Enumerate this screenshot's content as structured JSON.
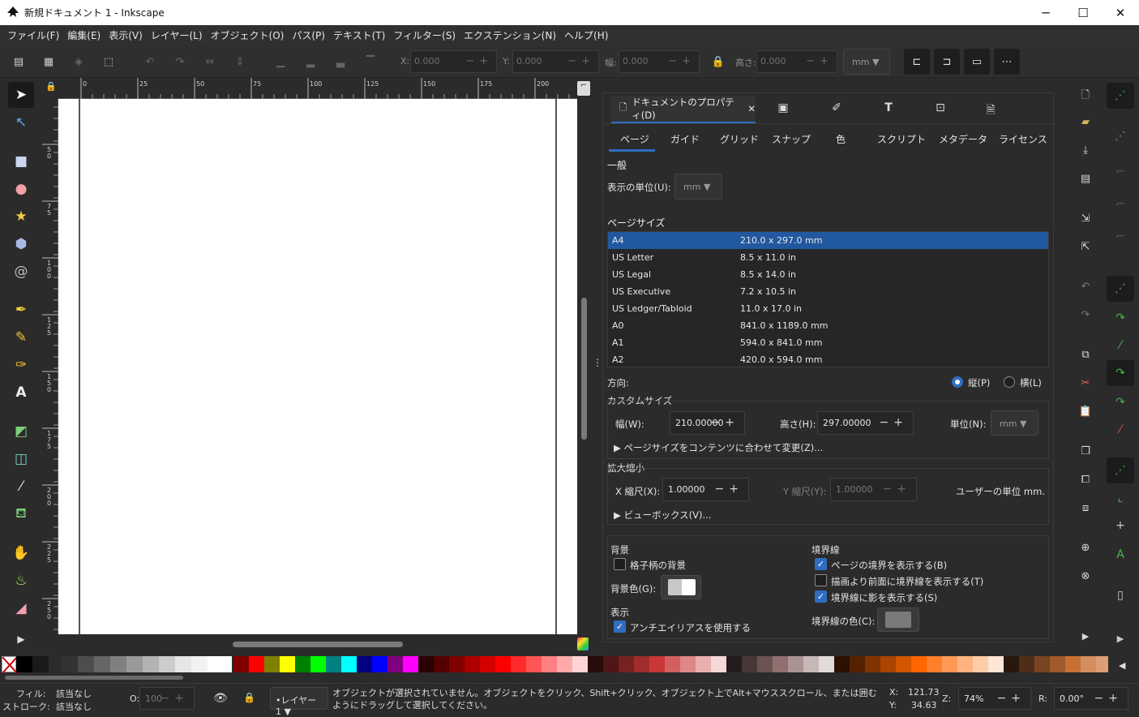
{
  "window": {
    "title": "新規ドキュメント 1 - Inkscape",
    "minimize": "─",
    "maximize": "☐",
    "close": "✕"
  },
  "menu": [
    "ファイル(F)",
    "編集(E)",
    "表示(V)",
    "レイヤー(L)",
    "オブジェクト(O)",
    "パス(P)",
    "テキスト(T)",
    "フィルター(S)",
    "エクステンション(N)",
    "ヘルプ(H)"
  ],
  "toolcontrols": {
    "x_label": "X:",
    "x_value": "0.000",
    "y_label": "Y:",
    "y_value": "0.000",
    "w_label": "幅:",
    "w_value": "0.000",
    "h_label": "高さ:",
    "h_value": "0.000",
    "unit": "mm"
  },
  "ruler": {
    "ticks": [
      "0",
      "25",
      "50",
      "75",
      "100",
      "125",
      "150",
      "175",
      "200"
    ],
    "vticks": [
      "5",
      "0",
      "7",
      "5",
      "1",
      "0",
      "0",
      "1",
      "2",
      "5",
      "1",
      "5",
      "0",
      "1",
      "7",
      "5",
      "2",
      "0",
      "0",
      "2",
      "2",
      "5",
      "2",
      "5",
      "0"
    ]
  },
  "dock": {
    "tab_title": "ドキュメントのプロパティ(D)",
    "subtabs": [
      "ページ",
      "ガイド",
      "グリッド",
      "スナップ",
      "色",
      "スクリプト",
      "メタデータ",
      "ライセンス"
    ],
    "general_label": "一般",
    "display_unit_label": "表示の単位(U):",
    "display_unit_value": "mm",
    "page_size_label": "ページサイズ",
    "sizes": [
      {
        "name": "A4",
        "dim": "210.0 x 297.0 mm"
      },
      {
        "name": "US Letter",
        "dim": "8.5 x 11.0 in"
      },
      {
        "name": "US Legal",
        "dim": "8.5 x 14.0 in"
      },
      {
        "name": "US Executive",
        "dim": "7.2 x 10.5 in"
      },
      {
        "name": "US Ledger/Tabloid",
        "dim": "11.0 x 17.0 in"
      },
      {
        "name": "A0",
        "dim": "841.0 x 1189.0 mm"
      },
      {
        "name": "A1",
        "dim": "594.0 x 841.0 mm"
      },
      {
        "name": "A2",
        "dim": "420.0 x 594.0 mm"
      }
    ],
    "orientation_label": "方向:",
    "portrait": "縦(P)",
    "landscape": "横(L)",
    "custom_size_label": "カスタムサイズ",
    "width_label": "幅(W):",
    "width_value": "210.00000",
    "height_label": "高さ(H):",
    "height_value": "297.00000",
    "units_label": "単位(N):",
    "units_value": "mm",
    "resize_label": "ページサイズをコンテンツに合わせて変更(Z)...",
    "scale_label": "拡大縮小",
    "xscale_label": "X 縮尺(X):",
    "xscale_value": "1.00000",
    "yscale_label": "Y 縮尺(Y):",
    "yscale_value": "1.00000",
    "user_units": "ユーザーの単位 mm.",
    "viewbox_label": "ビューボックス(V)...",
    "background_label": "背景",
    "checker_label": "格子柄の背景",
    "bgcolor_label": "背景色(G):",
    "display_label": "表示",
    "antialias_label": "アンチエイリアスを使用する",
    "border_label": "境界線",
    "show_border": "ページの境界を表示する(B)",
    "border_top": "描画より前面に境界線を表示する(T)",
    "border_shadow": "境界線に影を表示する(S)",
    "border_color_label": "境界線の色(C):"
  },
  "status": {
    "fill_label": "フィル:",
    "fill_value": "該当なし",
    "stroke_label": "ストローク:",
    "stroke_value": "該当なし",
    "opacity_label": "O:",
    "opacity_value": "100",
    "layer": "•レイヤー 1",
    "message": "オブジェクトが選択されていません。オブジェクトをクリック、Shift+クリック、オブジェクト上でAlt+マウススクロール、または囲むようにドラッグして選択してください。",
    "x_label": "X:",
    "x_value": "121.73",
    "y_label": "Y:",
    "y_value": "34.63",
    "zoom_label": "Z:",
    "zoom_value": "74%",
    "rotate_label": "R:",
    "rotate_value": "0.00°"
  },
  "colors": {
    "accent": "#2f6dbf",
    "selection": "#2158a0"
  }
}
